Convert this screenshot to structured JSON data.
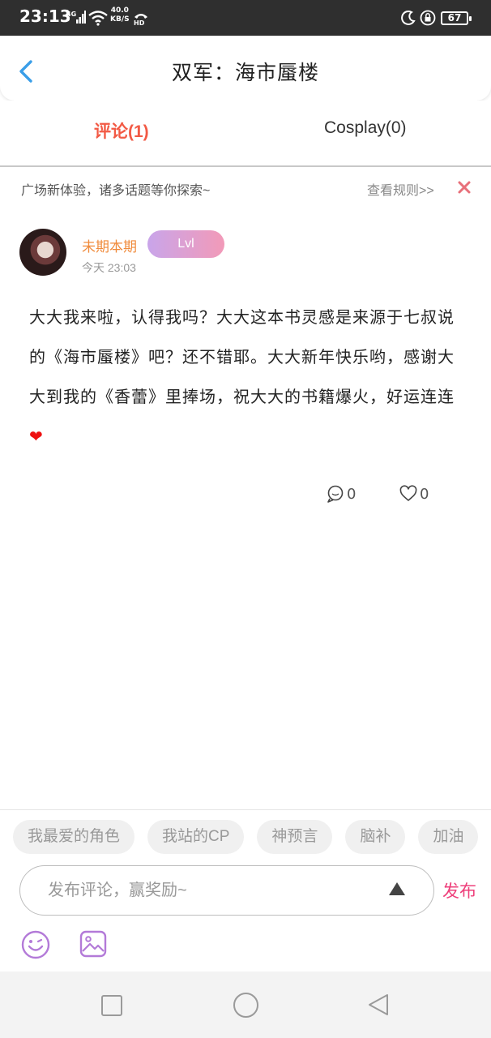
{
  "status_bar": {
    "time": "23:13",
    "network": "4G",
    "speed_value": "40.0",
    "speed_unit": "KB/S",
    "hd_label": "HD",
    "battery": "67",
    "icons": [
      "signal-icon",
      "wifi-icon",
      "hd-call-icon",
      "moon-icon",
      "lock-icon",
      "battery-icon"
    ]
  },
  "header": {
    "title": "双军：海市蜃楼",
    "back_icon": "chevron-left-icon"
  },
  "tabs": [
    {
      "label": "评论(1)",
      "active": true
    },
    {
      "label": "Cosplay(0)",
      "active": false
    }
  ],
  "notice": {
    "text": "广场新体验，诸多话题等你探索~",
    "rules_link": "查看规则>>",
    "close_icon": "close-icon"
  },
  "comment": {
    "username": "未期本期",
    "level": "Lvl",
    "time": "今天 23:03",
    "body": "大大我来啦，认得我吗？大大这本书灵感是来源于七叔说的《海市蜃楼》吧？还不错耶。大大新年快乐哟，感谢大大到我的《香蕾》里捧场，祝大大的书籍爆火，好运连连",
    "body_emoji": "❤",
    "reply_count": "0",
    "like_count": "0"
  },
  "composer": {
    "quick_tags": [
      "我最爱的角色",
      "我站的CP",
      "神预言",
      "脑补",
      "加油"
    ],
    "placeholder": "发布评论，赢奖励~",
    "publish_label": "发布",
    "emoji_icon": "smiley-icon",
    "image_icon": "image-icon"
  },
  "colors": {
    "active_tab": "#f25a45",
    "username": "#f08b3c",
    "publish": "#ee3f7a",
    "back_arrow": "#3a9ee8",
    "close": "#e8707a",
    "accent_purple": "#b37ad8"
  }
}
